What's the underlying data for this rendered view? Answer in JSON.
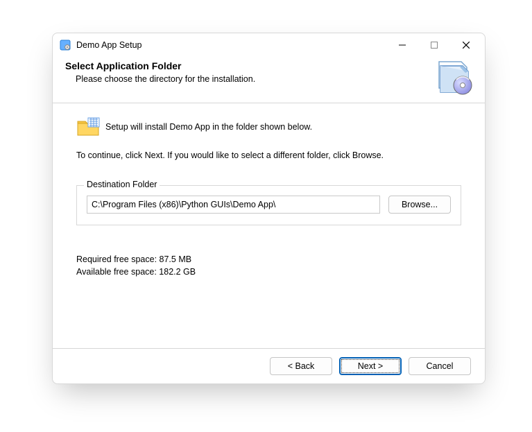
{
  "titlebar": {
    "title": "Demo App Setup"
  },
  "header": {
    "title": "Select Application Folder",
    "subtitle": "Please choose the directory for the installation."
  },
  "body": {
    "intro": "Setup will install Demo App in the folder shown below.",
    "continue": "To continue, click Next. If you would like to select a different folder, click Browse.",
    "group_label": "Destination Folder",
    "path_value": "C:\\Program Files (x86)\\Python GUIs\\Demo App\\",
    "browse_label": "Browse...",
    "required_space": "Required free space: 87.5 MB",
    "available_space": "Available free space: 182.2 GB"
  },
  "footer": {
    "back_label": "< Back",
    "next_label": "Next >",
    "cancel_label": "Cancel"
  }
}
